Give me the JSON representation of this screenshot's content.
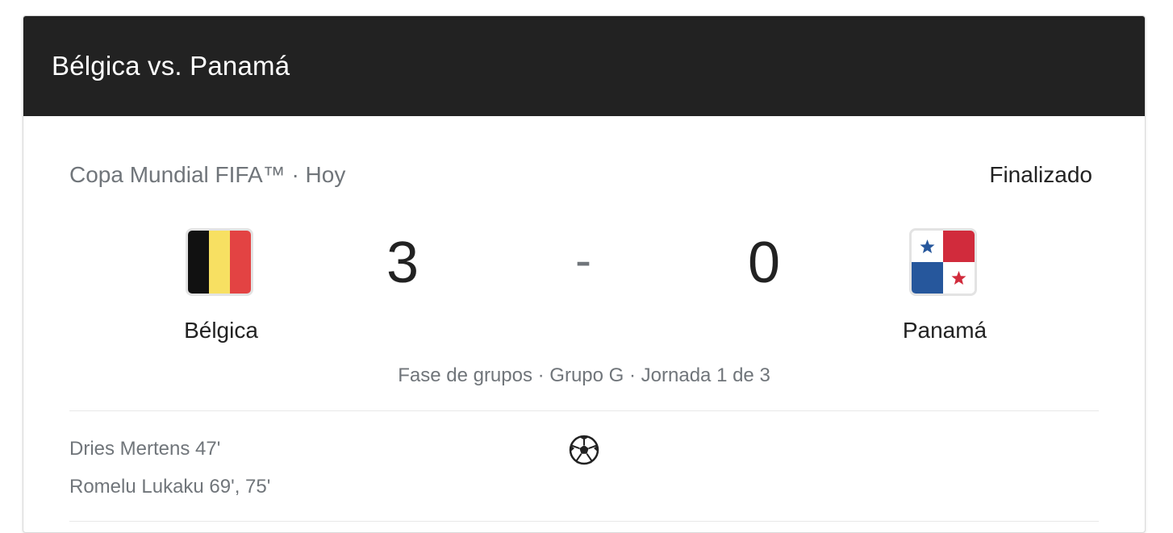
{
  "header": {
    "title": "Bélgica vs. Panamá"
  },
  "match": {
    "competition": "Copa Mundial FIFA™ · Hoy",
    "status": "Finalizado",
    "home": {
      "name": "Bélgica",
      "score": "3",
      "flag_colors": [
        "#111111",
        "#f7e062",
        "#e34343"
      ]
    },
    "away": {
      "name": "Panamá",
      "score": "0",
      "flag_colors": [
        "#ffffff",
        "#d12b3c",
        "#26579c"
      ]
    },
    "separator": "-",
    "stage": "Fase de grupos · Grupo G · Jornada 1 de 3"
  },
  "goals": {
    "icon": "soccer-ball-icon",
    "home_scorers": [
      "Dries Mertens 47'",
      "Romelu Lukaku 69', 75'"
    ]
  }
}
